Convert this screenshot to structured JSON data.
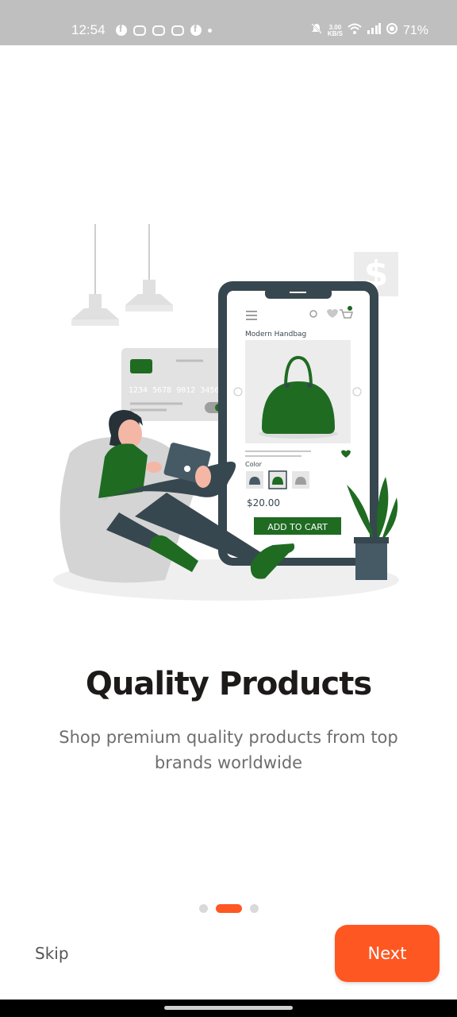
{
  "status_bar": {
    "time": "12:54",
    "network_speed_value": "3.00",
    "network_speed_unit": "KB/S",
    "battery": "71%"
  },
  "illustration": {
    "phone_product_title": "Modern Handbag",
    "color_label": "Color",
    "price": "$20.00",
    "add_to_cart_label": "ADD TO CART",
    "card_number": "1234 5678 9012 3456",
    "dollar_sign": "$",
    "colors": {
      "green": "#1f6b22",
      "dark": "#37474f",
      "slate": "#455a64",
      "grey": "#c8c8c8",
      "skin": "#f4b7a6"
    }
  },
  "onboarding": {
    "title": "Quality Products",
    "subtitle": "Shop premium quality products from top brands worldwide",
    "current_page": 2,
    "total_pages": 3
  },
  "actions": {
    "skip_label": "Skip",
    "next_label": "Next"
  },
  "accent_color": "#ff5722"
}
